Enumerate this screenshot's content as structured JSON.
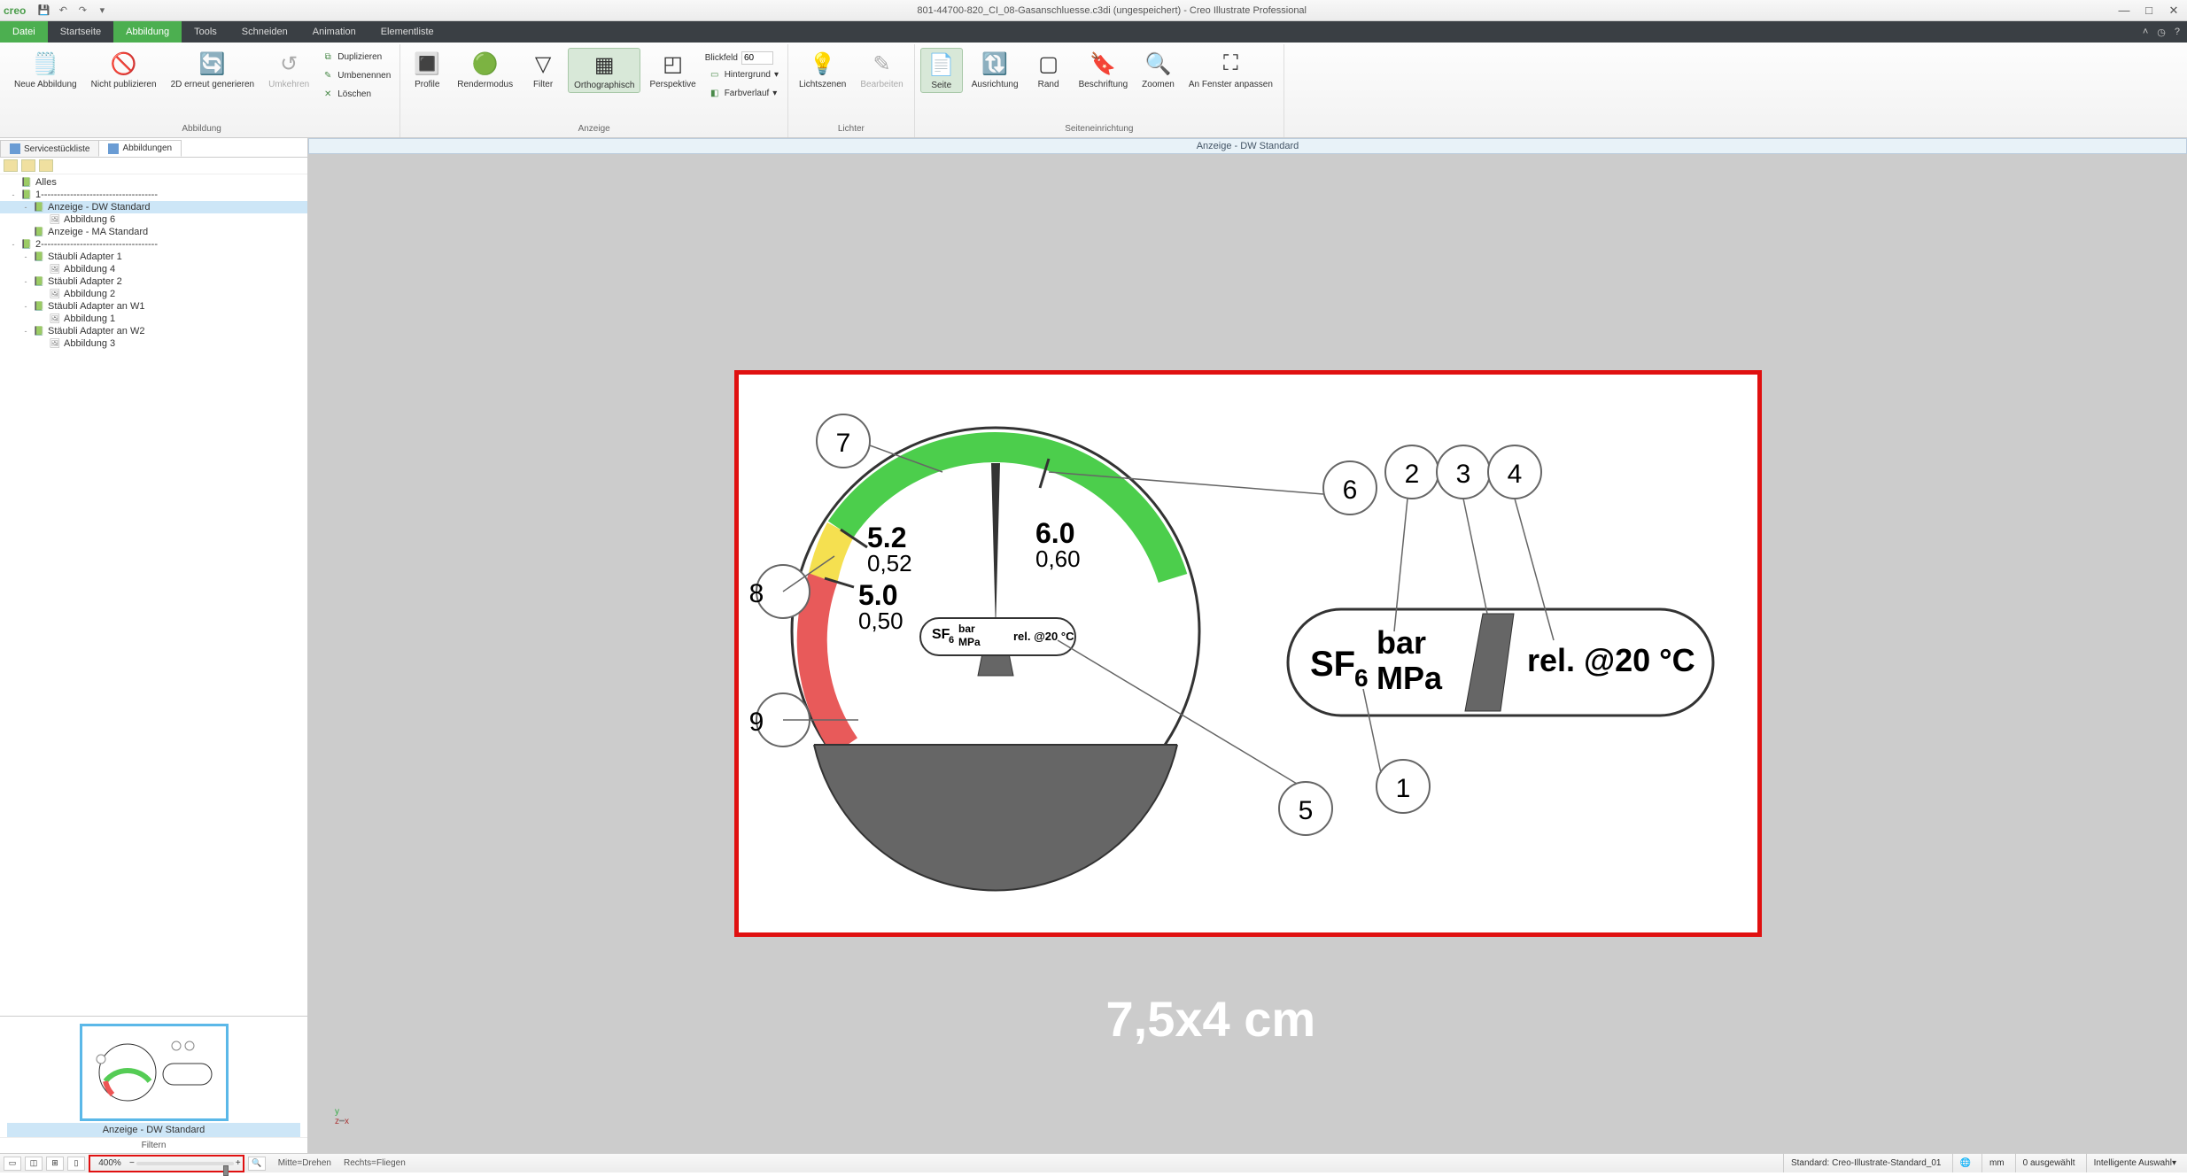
{
  "app": {
    "name": "creo",
    "title": "801-44700-820_CI_08-Gasanschluesse.c3di (ungespeichert) - Creo Illustrate Professional"
  },
  "tabs": {
    "file": "Datei",
    "items": [
      "Startseite",
      "Abbildung",
      "Tools",
      "Schneiden",
      "Animation",
      "Elementliste"
    ],
    "active": "Abbildung"
  },
  "ribbon": {
    "abbildung_group": "Abbildung",
    "anzeige_group": "Anzeige",
    "lichter_group": "Lichter",
    "seiteneinrichtung_group": "Seiteneinrichtung",
    "neue_abbildung": "Neue\nAbbildung",
    "nicht_publizieren": "Nicht\npublizieren",
    "d_erneut_generieren": "2D erneut\ngenerieren",
    "umkehren": "Umkehren",
    "duplizieren": "Duplizieren",
    "umbenennen": "Umbenennen",
    "loeschen": "Löschen",
    "profile": "Profile",
    "rendermodus": "Rendermodus",
    "filter": "Filter",
    "orthographisch": "Orthographisch",
    "perspektive": "Perspektive",
    "blickfeld": "Blickfeld",
    "blickfeld_val": "60",
    "hintergrund": "Hintergrund",
    "farbverlauf": "Farbverlauf",
    "lichtszenen": "Lichtszenen",
    "bearbeiten": "Bearbeiten",
    "seite": "Seite",
    "ausrichtung": "Ausrichtung",
    "rand": "Rand",
    "beschriftung": "Beschriftung",
    "zoomen": "Zoomen",
    "an_fenster": "An Fenster\nanpassen"
  },
  "left": {
    "tab1": "Servicestückliste",
    "tab2": "Abbildungen",
    "tree": [
      {
        "lvl": 0,
        "exp": "",
        "ico": "page",
        "label": "Alles"
      },
      {
        "lvl": 0,
        "exp": "-",
        "ico": "page",
        "label": "1------------------------------------"
      },
      {
        "lvl": 1,
        "exp": "-",
        "ico": "page",
        "label": "Anzeige - DW Standard",
        "sel": true
      },
      {
        "lvl": 2,
        "exp": "",
        "ico": "fig",
        "label": "Abbildung 6"
      },
      {
        "lvl": 1,
        "exp": "",
        "ico": "page",
        "label": "Anzeige - MA Standard"
      },
      {
        "lvl": 0,
        "exp": "-",
        "ico": "page",
        "label": "2------------------------------------"
      },
      {
        "lvl": 1,
        "exp": "-",
        "ico": "page",
        "label": "Stäubli Adapter 1"
      },
      {
        "lvl": 2,
        "exp": "",
        "ico": "fig",
        "label": "Abbildung 4"
      },
      {
        "lvl": 1,
        "exp": "-",
        "ico": "page",
        "label": "Stäubli Adapter 2"
      },
      {
        "lvl": 2,
        "exp": "",
        "ico": "fig",
        "label": "Abbildung 2"
      },
      {
        "lvl": 1,
        "exp": "-",
        "ico": "page",
        "label": "Stäubli Adapter an W1"
      },
      {
        "lvl": 2,
        "exp": "",
        "ico": "fig",
        "label": "Abbildung 1"
      },
      {
        "lvl": 1,
        "exp": "-",
        "ico": "page",
        "label": "Stäubli Adapter an W2"
      },
      {
        "lvl": 2,
        "exp": "",
        "ico": "fig",
        "label": "Abbildung 3"
      }
    ],
    "thumb_label": "Anzeige - DW Standard",
    "filtern": "Filtern"
  },
  "canvas": {
    "header": "Anzeige - DW Standard",
    "dim_label": "7,5x4 cm",
    "gauge": {
      "v1_top": "5.2",
      "v1_bot": "0,52",
      "v2_top": "5.0",
      "v2_bot": "0,50",
      "v3_top": "6.0",
      "v3_bot": "0,60",
      "center_label": "SF₆",
      "center_bar": "bar",
      "center_mpa": "MPa",
      "center_rel": "rel. @20 °C",
      "callouts": [
        "1",
        "2",
        "3",
        "4",
        "5",
        "6",
        "7",
        "8",
        "9"
      ]
    },
    "legend": {
      "sf6": "SF",
      "sf6_sub": "6",
      "bar": "bar",
      "mpa": "MPa",
      "rel": "rel. @20 °C"
    }
  },
  "status": {
    "zoom": "400%",
    "hint1": "Mitte=Drehen",
    "hint2": "Rechts=Fliegen",
    "standard": "Standard: Creo-Illustrate-Standard_01",
    "unit": "mm",
    "sel": "0 ausgewählt",
    "mode": "Intelligente Auswahl"
  }
}
